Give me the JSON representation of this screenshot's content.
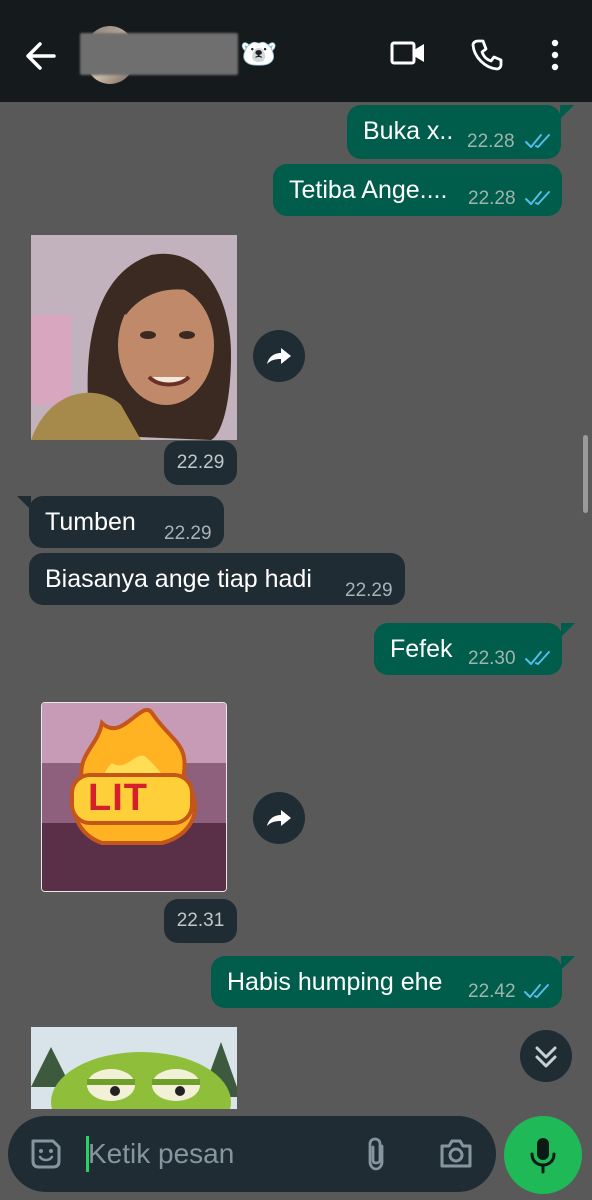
{
  "header": {
    "back_icon": "arrow-left-icon",
    "contact_emoji": "🐻‍❄️",
    "video_icon": "video-call-icon",
    "call_icon": "phone-icon",
    "menu_icon": "more-vertical-icon"
  },
  "messages": [
    {
      "direction": "out",
      "text": "Buka x..",
      "time": "22.28",
      "status": "read"
    },
    {
      "direction": "out",
      "text": "Tetiba Ange....",
      "time": "22.28",
      "status": "read"
    },
    {
      "direction": "in",
      "type": "image",
      "time": "22.29"
    },
    {
      "direction": "in",
      "text": "Tumben",
      "time": "22.29"
    },
    {
      "direction": "in",
      "text": "Biasanya ange tiap hadi",
      "time": "22.29"
    },
    {
      "direction": "out",
      "text": "Fefek",
      "time": "22.30",
      "status": "read"
    },
    {
      "direction": "in",
      "type": "sticker",
      "sticker_text": "LIT",
      "time": "22.31"
    },
    {
      "direction": "out",
      "text": "Habis humping ehe",
      "time": "22.42",
      "status": "read"
    },
    {
      "direction": "in",
      "type": "image",
      "time": ""
    }
  ],
  "composer": {
    "placeholder": "Ketik pesan",
    "emoji_icon": "sticker-icon",
    "attach_icon": "paperclip-icon",
    "camera_icon": "camera-icon",
    "mic_icon": "microphone-icon"
  },
  "colors": {
    "header_bg": "#151a1d",
    "chat_bg": "#595959",
    "outgoing_bubble": "#005c4b",
    "incoming_bubble": "#1f2c33",
    "read_ticks": "#53bdeb",
    "mic_button": "#1fb958"
  }
}
